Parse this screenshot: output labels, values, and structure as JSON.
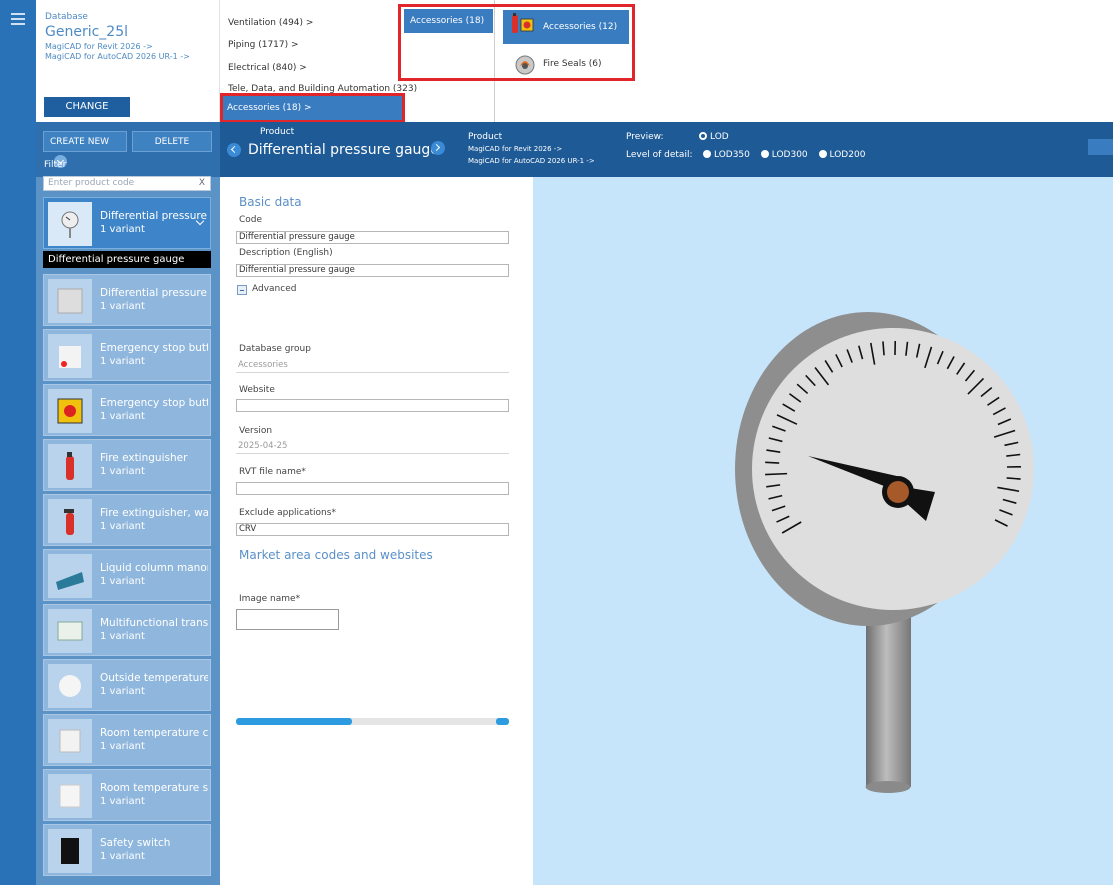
{
  "database": {
    "label": "Database",
    "name": "Generic_25l",
    "line1": "MagiCAD for Revit 2026 ->",
    "line2": "MagiCAD for AutoCAD 2026 UR-1 ->",
    "change_label": "CHANGE"
  },
  "toolbar": {
    "create_label": "CREATE NEW",
    "delete_label": "DELETE",
    "filter_label": "Filter",
    "filter_placeholder": "Enter product code",
    "filter_clear": "X"
  },
  "products": [
    {
      "name": "Differential pressure",
      "variant": "1 variant",
      "selected": true
    },
    {
      "name": "Differential pressure t",
      "variant": "1 variant"
    },
    {
      "name": "Emergency stop buttc",
      "variant": "1 variant"
    },
    {
      "name": "Emergency stop buttc",
      "variant": "1 variant"
    },
    {
      "name": "Fire extinguisher",
      "variant": "1 variant"
    },
    {
      "name": "Fire extinguisher, wall",
      "variant": "1 variant"
    },
    {
      "name": "Liquid column manon",
      "variant": "1 variant"
    },
    {
      "name": "Multifunctional transr",
      "variant": "1 variant"
    },
    {
      "name": "Outside temperature",
      "variant": "1 variant"
    },
    {
      "name": "Room temperature cc",
      "variant": "1 variant"
    },
    {
      "name": "Room temperature se",
      "variant": "1 variant"
    },
    {
      "name": "Safety switch",
      "variant": "1 variant"
    }
  ],
  "selected_variant": "Differential pressure gauge",
  "categories": [
    "Ventilation (494)  >",
    "Piping (1717)  >",
    "Electrical (840)  >",
    "Tele, Data, and Building Automation (323)",
    "Accessories (18)  >"
  ],
  "subcategory": "Accessories (18)  >",
  "subitems": [
    "Accessories (12)",
    "Fire Seals (6)"
  ],
  "productbar": {
    "product_label": "Product",
    "product_name": "Differential pressure gauge",
    "product_label2": "Product",
    "app1": "MagiCAD for Revit 2026 ->",
    "app2": "MagiCAD for AutoCAD 2026 UR-1 ->",
    "preview_label": "Preview:",
    "preview_opt": "LOD",
    "lod_label": "Level of detail:",
    "lod_opts": [
      "LOD350",
      "LOD300",
      "LOD200"
    ]
  },
  "form": {
    "basic_title": "Basic data",
    "code_label": "Code",
    "code_value": "Differential pressure gauge",
    "desc_label": "Description (English)",
    "desc_value": "Differential pressure gauge",
    "advanced_label": "Advanced",
    "dbgroup_label": "Database group",
    "dbgroup_value": "Accessories",
    "website_label": "Website",
    "website_value": "",
    "version_label": "Version",
    "version_value": "2025-04-25",
    "rvt_label": "RVT file name*",
    "rvt_value": "",
    "exclude_label": "Exclude applications*",
    "exclude_value": "CRV",
    "market_title": "Market area codes and websites",
    "image_label": "Image name*"
  }
}
